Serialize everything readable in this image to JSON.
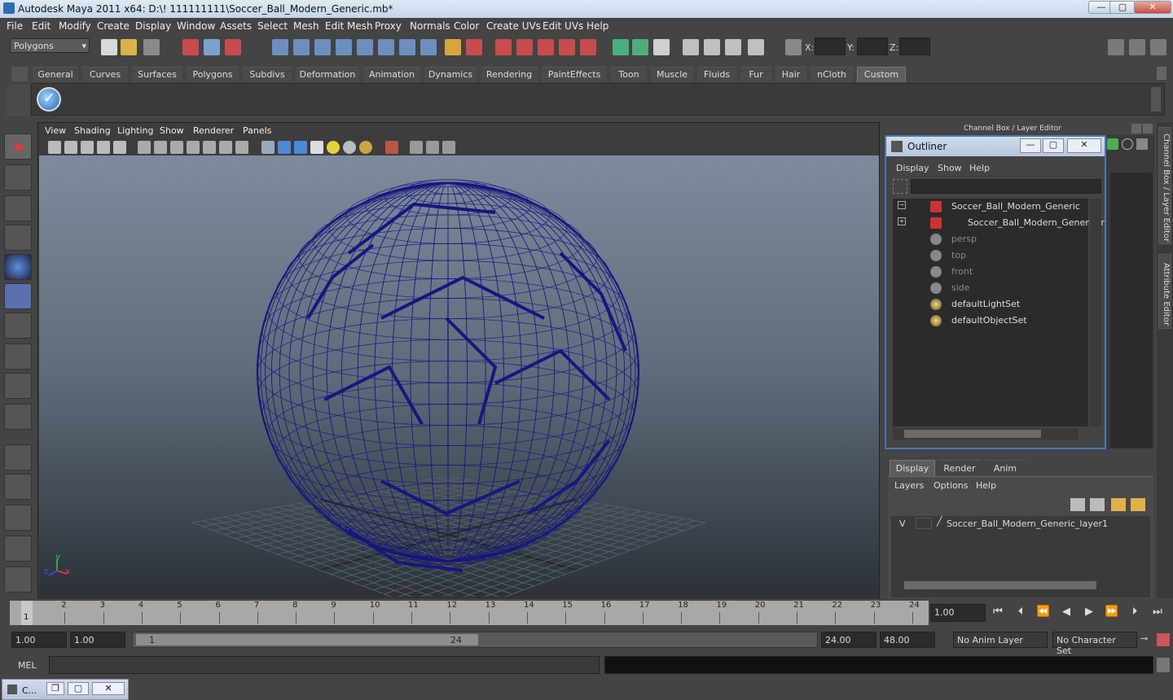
{
  "window": {
    "title": "Autodesk Maya 2011 x64: D:\\! 111111111\\Soccer_Ball_Modern_Generic.mb*",
    "min": "—",
    "max": "▢",
    "close": "✕"
  },
  "menubar": [
    "File",
    "Edit",
    "Modify",
    "Create",
    "Display",
    "Window",
    "Assets",
    "Select",
    "Mesh",
    "Edit Mesh",
    "Proxy",
    "Normals",
    "Color",
    "Create UVs",
    "Edit UVs",
    "Help"
  ],
  "status": {
    "mode": "Polygons",
    "x_label": "X:",
    "y_label": "Y:",
    "z_label": "Z:"
  },
  "shelf_tabs": [
    "General",
    "Curves",
    "Surfaces",
    "Polygons",
    "Subdivs",
    "Deformation",
    "Animation",
    "Dynamics",
    "Rendering",
    "PaintEffects",
    "Toon",
    "Muscle",
    "Fluids",
    "Fur",
    "Hair",
    "nCloth",
    "Custom"
  ],
  "shelf_active": "Custom",
  "panel_menu": [
    "View",
    "Shading",
    "Lighting",
    "Show",
    "Renderer",
    "Panels"
  ],
  "axis": {
    "y": "y",
    "x": "x",
    "z": "z"
  },
  "viewport": {
    "wire_color": "#16177e",
    "background_top": "#7d8b9c",
    "background_bottom": "#2c3138"
  },
  "channelbox": {
    "title": "Channel Box / Layer Editor"
  },
  "outliner": {
    "title": "Outliner",
    "menu": [
      "Display",
      "Show",
      "Help"
    ],
    "items": [
      {
        "label": "Soccer_Ball_Modern_Generic",
        "icon": "mesh-icon",
        "dim": false
      },
      {
        "label": "Soccer_Ball_Modern_Generic_r",
        "icon": "mesh-icon",
        "dim": false
      },
      {
        "label": "persp",
        "icon": "camera-icon",
        "dim": true
      },
      {
        "label": "top",
        "icon": "camera-icon",
        "dim": true
      },
      {
        "label": "front",
        "icon": "camera-icon",
        "dim": true
      },
      {
        "label": "side",
        "icon": "camera-icon",
        "dim": true
      },
      {
        "label": "defaultLightSet",
        "icon": "set-icon",
        "dim": false
      },
      {
        "label": "defaultObjectSet",
        "icon": "set-icon",
        "dim": false
      }
    ]
  },
  "sidetabs": [
    "Channel Box / Layer Editor",
    "Attribute Editor"
  ],
  "layers": {
    "tabs": [
      "Display",
      "Render",
      "Anim"
    ],
    "menu": [
      "Layers",
      "Options",
      "Help"
    ],
    "visible": "V",
    "layer_name": "Soccer_Ball_Modern_Generic_layer1"
  },
  "timeline": {
    "ticks": [
      "1",
      "2",
      "3",
      "4",
      "5",
      "6",
      "7",
      "8",
      "9",
      "10",
      "11",
      "12",
      "13",
      "14",
      "15",
      "16",
      "17",
      "18",
      "19",
      "20",
      "21",
      "22",
      "23",
      "24"
    ],
    "current": "1",
    "current_field": "1.00"
  },
  "range": {
    "start": "1.00",
    "start2": "1.00",
    "slider_start": "1",
    "slider_end": "24",
    "end": "24.00",
    "end2": "48.00",
    "anim_layer": "No Anim Layer",
    "char_set": "No Character Set"
  },
  "cmd": {
    "label": "MEL"
  },
  "taskbar": {
    "label": "C..."
  }
}
